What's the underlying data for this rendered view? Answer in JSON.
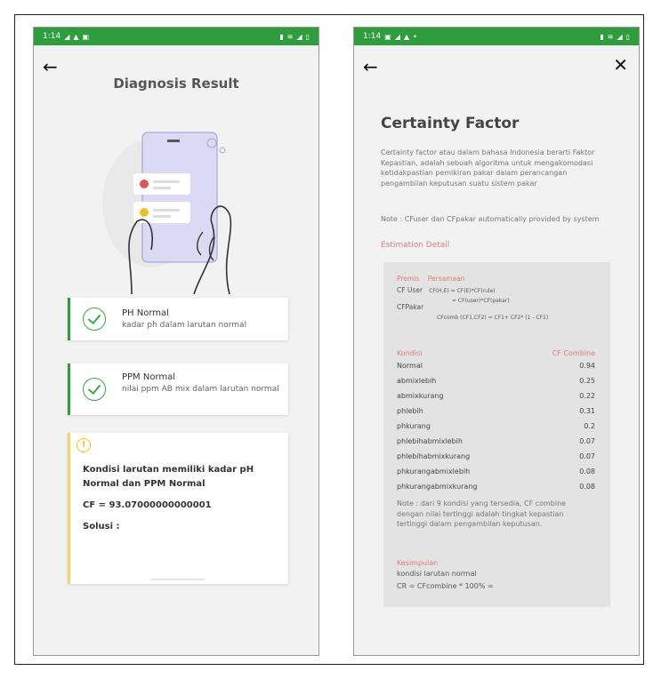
{
  "left_screen": {
    "status": {
      "time": "1:14"
    },
    "title": "Diagnosis Result",
    "cards": [
      {
        "title": "PH Normal",
        "subtitle": "kadar ph dalam larutan normal"
      },
      {
        "title": "PPM Normal",
        "subtitle": "nilai ppm AB mix dalam larutan normal"
      }
    ],
    "result": {
      "message": "Kondisi larutan memiliki kadar pH Normal dan PPM Normal",
      "cf": "CF = 93.07000000000001",
      "solution_label": "Solusi :"
    }
  },
  "right_screen": {
    "status": {
      "time": "1:14"
    },
    "title": "Certainty Factor",
    "description": "Certainty factor atau dalam bahasa Indonesia berarti Faktor Kepastian, adalah sebuah algoritma untuk mengakomodasi ketidakpastian pemikiran pakar dalam perancangan pengambilan keputusan suatu sistem pakar",
    "note": "Note : CFuser dan CFpakar automatically provided by system",
    "estimation_label": "Estimation Detail",
    "premis_label": "Premis",
    "persamaan_label": "Persamaan",
    "cf_user_label": "CF User",
    "cf_user_eq": "CF(H,E) = CF(E)*CF(rule)",
    "cf_pakar_label": "CFPakar",
    "cf_pakar_eq": "= CF(user)*CF(pakar)",
    "cf_comb_eq": "CFcomb (CF1,CF2) = CF1+ CF2* (1 - CF1)",
    "table_headers": {
      "kondisi": "Kondisi",
      "cf_combine": "CF Combine"
    },
    "rows": [
      {
        "kondisi": "Normal",
        "cf": "0.94"
      },
      {
        "kondisi": "abmixlebih",
        "cf": "0.25"
      },
      {
        "kondisi": "abmixkurang",
        "cf": "0.22"
      },
      {
        "kondisi": "phlebih",
        "cf": "0.31"
      },
      {
        "kondisi": "phkurang",
        "cf": "0.2"
      },
      {
        "kondisi": "phlebihabmixlebih",
        "cf": "0.07"
      },
      {
        "kondisi": "phlebihabmixkurang",
        "cf": "0.07"
      },
      {
        "kondisi": "phkurangabmixlebih",
        "cf": "0.08"
      },
      {
        "kondisi": "phkurangabmixkurang",
        "cf": "0.08"
      }
    ],
    "panel_note": "Note : dari 9 kondisi yang tersedia, CF combine dengan nilai tertinggi adalah tingkat kepastian tertinggi dalam pengambilan keputusan.",
    "kesimpulan_label": "Kesimpulan",
    "kesimpulan_value": "kondisi larutan normal",
    "cr_formula": "CR = CFcombine * 100% ="
  },
  "colors": {
    "status_green": "#2f9c3e",
    "card_green": "#2f9c3e",
    "warn_yellow": "#f4d46a",
    "accent_red": "#e07b7b"
  },
  "icons": [
    "back-arrow-icon",
    "close-icon",
    "check-circle-icon",
    "warning-circle-icon"
  ]
}
